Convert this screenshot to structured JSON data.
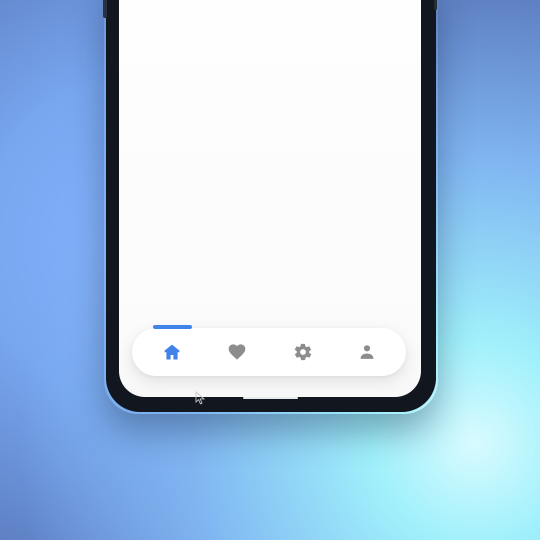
{
  "colors": {
    "accent": "#4283ea",
    "inactive_icon": "#8d8d8d",
    "phone_frame": "#11161f",
    "screen_background": "#fefefe"
  },
  "bottom_navigation": {
    "selected": "home",
    "items": [
      {
        "id": "home",
        "icon": "home-icon",
        "selected": true
      },
      {
        "id": "favorites",
        "icon": "heart-icon",
        "selected": false
      },
      {
        "id": "settings",
        "icon": "gear-icon",
        "selected": false
      },
      {
        "id": "profile",
        "icon": "person-icon",
        "selected": false
      }
    ]
  },
  "system": {
    "home_indicator": "visible",
    "cursor_icon": "arrow-cursor-icon"
  }
}
